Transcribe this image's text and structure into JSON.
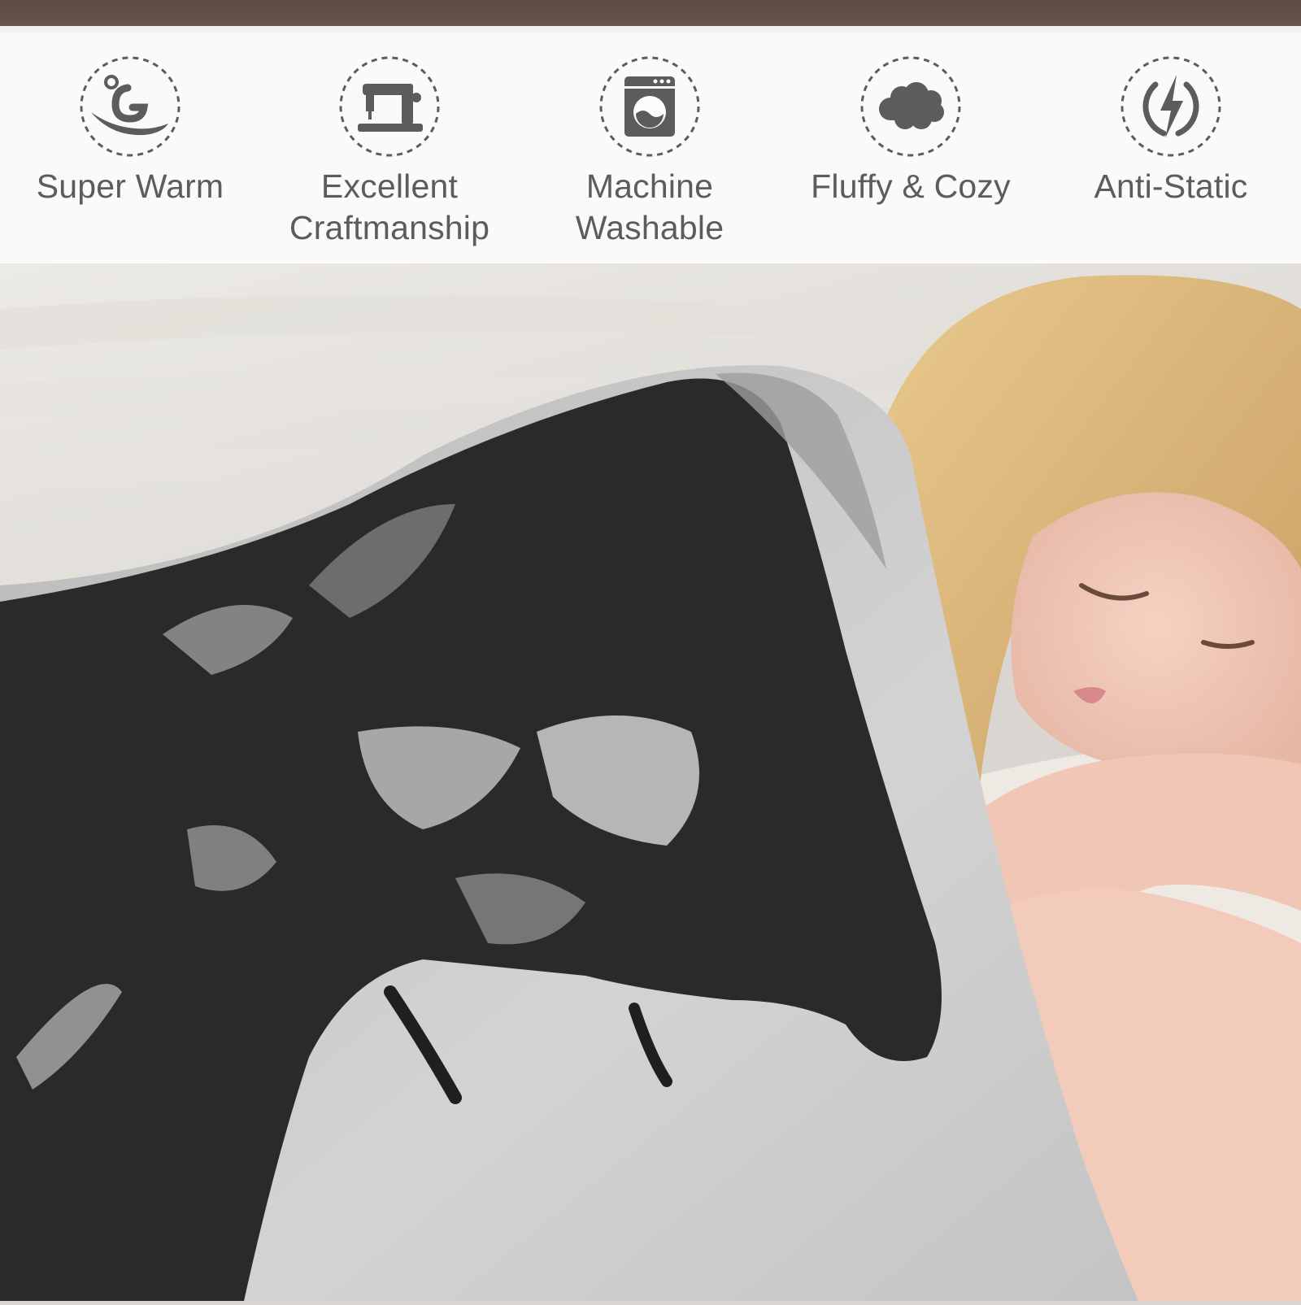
{
  "features": [
    {
      "label_line1": "Super Warm",
      "label_line2": "",
      "icon": "super-warm-icon"
    },
    {
      "label_line1": "Excellent",
      "label_line2": "Craftmanship",
      "icon": "sewing-machine-icon"
    },
    {
      "label_line1": "Machine",
      "label_line2": "Washable",
      "icon": "washing-machine-icon"
    },
    {
      "label_line1": "Fluffy & Cozy",
      "label_line2": "",
      "icon": "cloud-icon"
    },
    {
      "label_line1": "Anti-Static",
      "label_line2": "",
      "icon": "lightning-icon"
    }
  ],
  "colors": {
    "icon_gray": "#5c5c5c",
    "band_white": "#fcfcfc",
    "blanket_dark": "#2a2a2a",
    "blanket_light": "#c9c9c9"
  }
}
